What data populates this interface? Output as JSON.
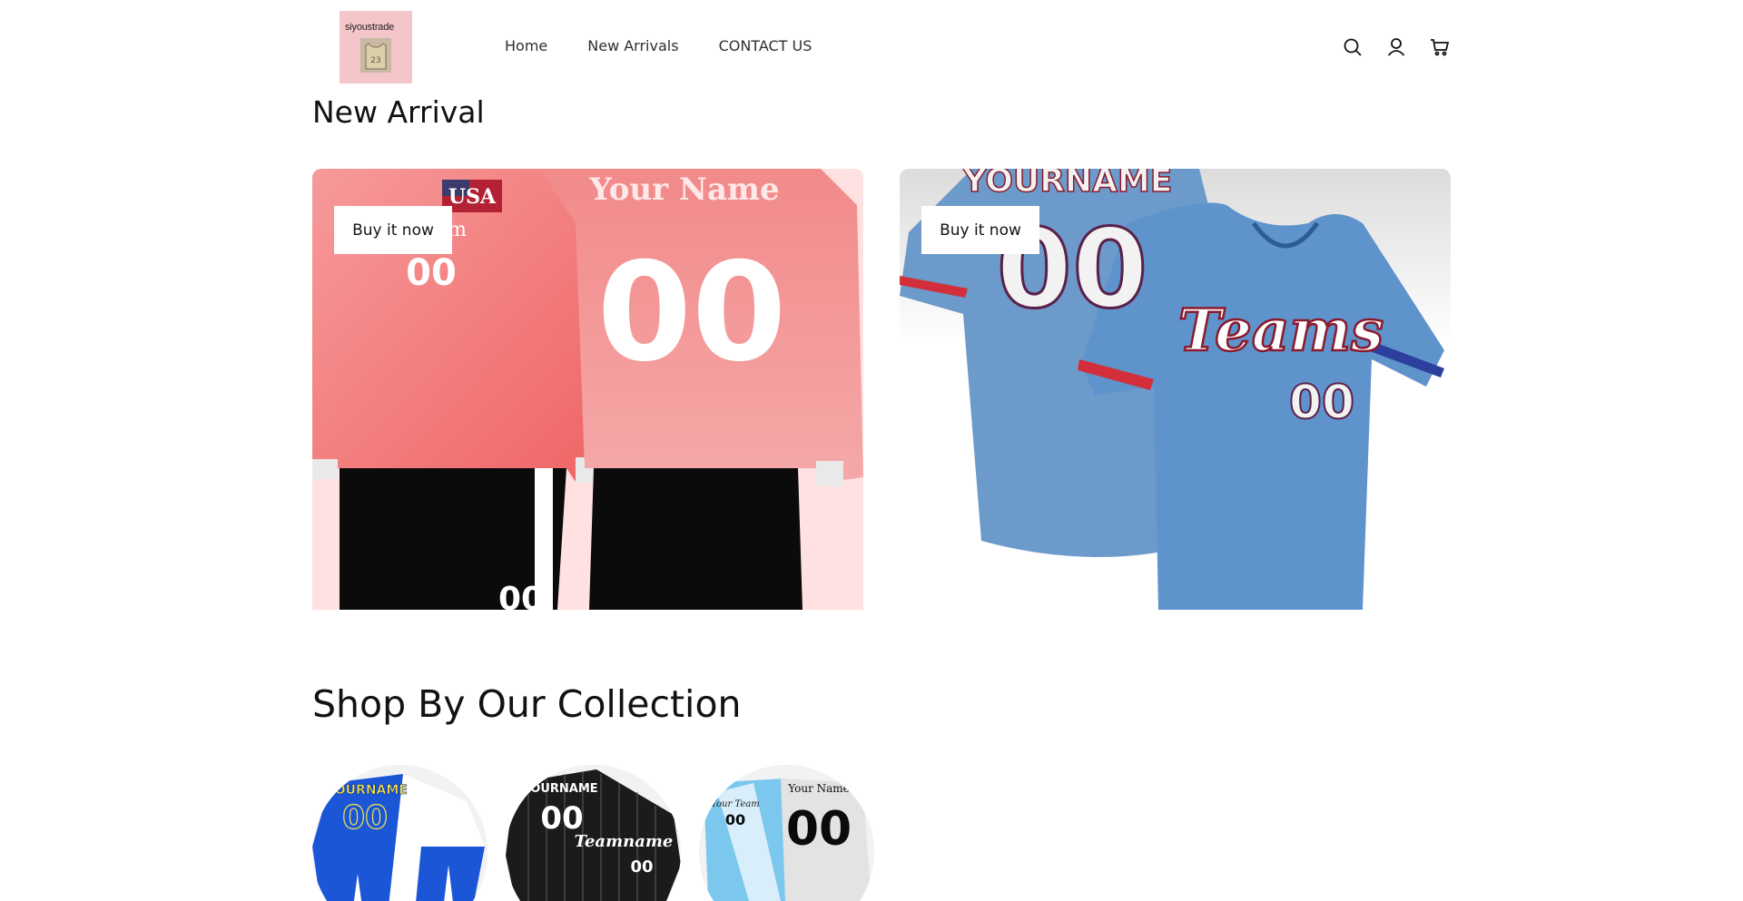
{
  "header": {
    "logo": {
      "text": "siyoustrade",
      "number": "23"
    },
    "nav": [
      {
        "label": "Home"
      },
      {
        "label": "New Arrivals"
      },
      {
        "label": "CONTACT US"
      }
    ],
    "icons": [
      "search-icon",
      "account-icon",
      "cart-icon"
    ]
  },
  "new_arrival": {
    "title": "New Arrival",
    "cards": [
      {
        "button_label": "Buy it now",
        "image_text": {
          "country": "USA",
          "team": "Team",
          "name": "Your Name",
          "number_front": "00",
          "number_back": "00"
        }
      },
      {
        "button_label": "Buy it now",
        "image_text": {
          "name": "YOURNAME",
          "number_back": "00",
          "team": "Teams",
          "number_front": "00"
        }
      }
    ]
  },
  "collection": {
    "title": "Shop By Our Collection",
    "items": [
      {
        "image_text": {
          "name": "YOURNAME",
          "number": "00"
        }
      },
      {
        "image_text": {
          "name": "YOURNAME",
          "number": "00",
          "team": "Teamname",
          "number_front": "00"
        }
      },
      {
        "image_text": {
          "team": "Your Team",
          "name": "Your Name",
          "number": "00"
        }
      }
    ]
  },
  "colors": {
    "text": "#121212",
    "logo_bg": "#f5c6c9",
    "jersey_pink": "#f07a7a",
    "jersey_blue": "#6a9cd0",
    "jersey_royal": "#1a56d6"
  }
}
